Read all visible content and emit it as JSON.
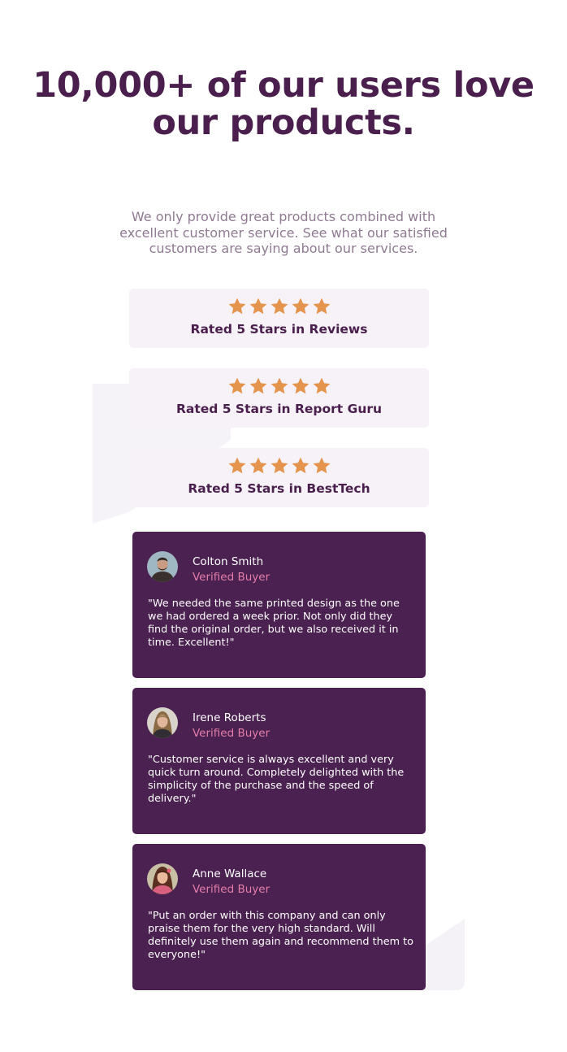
{
  "heading": "10,000+ of our users love our products.",
  "intro": "We only provide great products combined with excellent customer service. See what our satisfied customers are saying about our services.",
  "colors": {
    "heading": "#4a1f4d",
    "body_text": "#8f7a92",
    "rating_bg": "#f6f2f7",
    "star": "#e5944e",
    "card_bg": "#4a2150",
    "verified": "#e47ea9"
  },
  "ratings": [
    {
      "stars": 5,
      "label": "Rated 5 Stars in Reviews"
    },
    {
      "stars": 5,
      "label": "Rated 5 Stars in Report Guru"
    },
    {
      "stars": 5,
      "label": "Rated 5 Stars in BestTech"
    }
  ],
  "star_icon": "star-icon",
  "reviews": [
    {
      "name": "Colton Smith",
      "badge": "Verified Buyer",
      "quote": "\"We needed the same printed design as the one we had ordered a week prior. Not only did they find the original order, but we also received it in time. Excellent!\""
    },
    {
      "name": "Irene Roberts",
      "badge": "Verified Buyer",
      "quote": "\"Customer service is always excellent and very quick turn around. Completely delighted with the simplicity of the purchase and the speed of delivery.\""
    },
    {
      "name": "Anne Wallace",
      "badge": "Verified Buyer",
      "quote": "\"Put an order with this company and can only praise them for the very high standard. Will definitely use them again and recommend them to everyone!\""
    }
  ]
}
